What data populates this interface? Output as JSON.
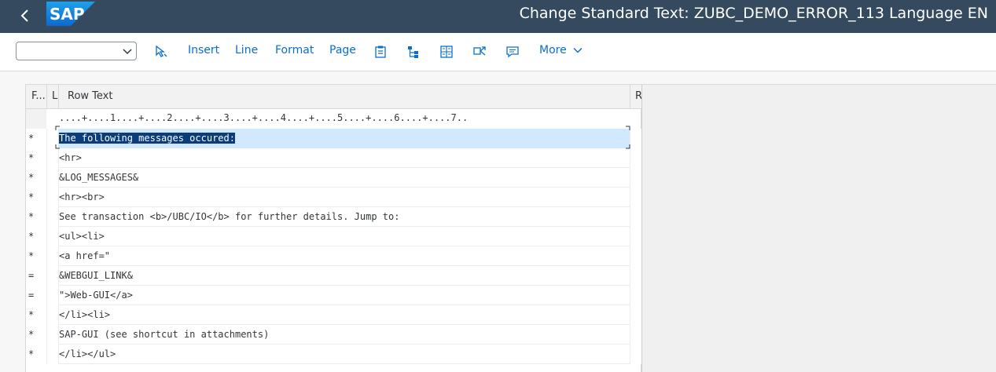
{
  "header": {
    "logo": "SAP",
    "title": "Change Standard Text: ZUBC_DEMO_ERROR_113 Language EN"
  },
  "toolbar": {
    "select_value": "",
    "insert_label": "Insert",
    "line_label": "Line",
    "format_label": "Format",
    "page_label": "Page",
    "more_label": "More"
  },
  "table": {
    "columns": {
      "f": "F...",
      "l": "L",
      "text": "Row Text",
      "r": "R"
    },
    "ruler": "....+....1....+....2....+....3....+....4....+....5....+....6....+....7..",
    "rows": [
      {
        "format": "*",
        "text": "The following messages occured:"
      },
      {
        "format": "*",
        "text": "<hr>"
      },
      {
        "format": "*",
        "text": "&LOG_MESSAGES&"
      },
      {
        "format": "*",
        "text": "<hr><br>"
      },
      {
        "format": "*",
        "text": "See transaction <b>/UBC/IO</b> for further details. Jump to:"
      },
      {
        "format": "*",
        "text": "<ul><li>"
      },
      {
        "format": "*",
        "text": "<a href=\""
      },
      {
        "format": "=",
        "text": "&WEBGUI_LINK&"
      },
      {
        "format": "=",
        "text": "\">Web-GUI</a>"
      },
      {
        "format": "*",
        "text": "</li><li>"
      },
      {
        "format": "*",
        "text": "SAP-GUI (see shortcut in attachments)"
      },
      {
        "format": "*",
        "text": "</li></ul>"
      }
    ]
  },
  "colors": {
    "shell": "#354a5f",
    "accent": "#0a6ed1",
    "selection": "#0a3d7a"
  }
}
